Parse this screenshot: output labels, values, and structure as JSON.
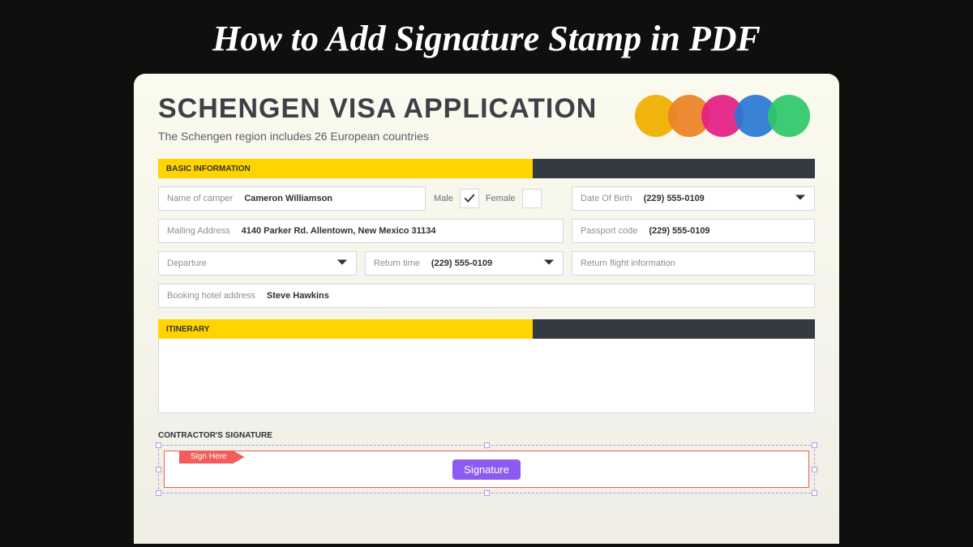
{
  "page": {
    "title": "How to Add Signature Stamp in PDF"
  },
  "document": {
    "title": "SCHENGEN VISA APPLICATION",
    "subtitle": "The Schengen region includes 26 European countries"
  },
  "sections": {
    "basic": "BASIC INFORMATION",
    "itinerary": "ITINERARY",
    "signature": "CONTRACTOR'S SIGNATURE"
  },
  "form": {
    "name_label": "Name of camper",
    "name_value": "Cameron Williamson",
    "gender_male": "Male",
    "gender_female": "Female",
    "dob_label": "Date Of Birth",
    "dob_value": "(229) 555-0109",
    "mail_label": "Mailing Address",
    "mail_value": "4140 Parker Rd. Allentown, New Mexico 31134",
    "passport_label": "Passport code",
    "passport_value": "(229) 555-0109",
    "departure_label": "Departure",
    "return_label": "Return time",
    "return_value": "(229) 555-0109",
    "flight_label": "Return flight information",
    "hotel_label": "Booking hotel address",
    "hotel_value": "Steve Hawkins"
  },
  "signature": {
    "sign_here": "Sign Here",
    "button": "Signature"
  },
  "logo_colors": [
    "#f6b400",
    "#f08427",
    "#e91e8e",
    "#2a7be4",
    "#2ecc71"
  ]
}
